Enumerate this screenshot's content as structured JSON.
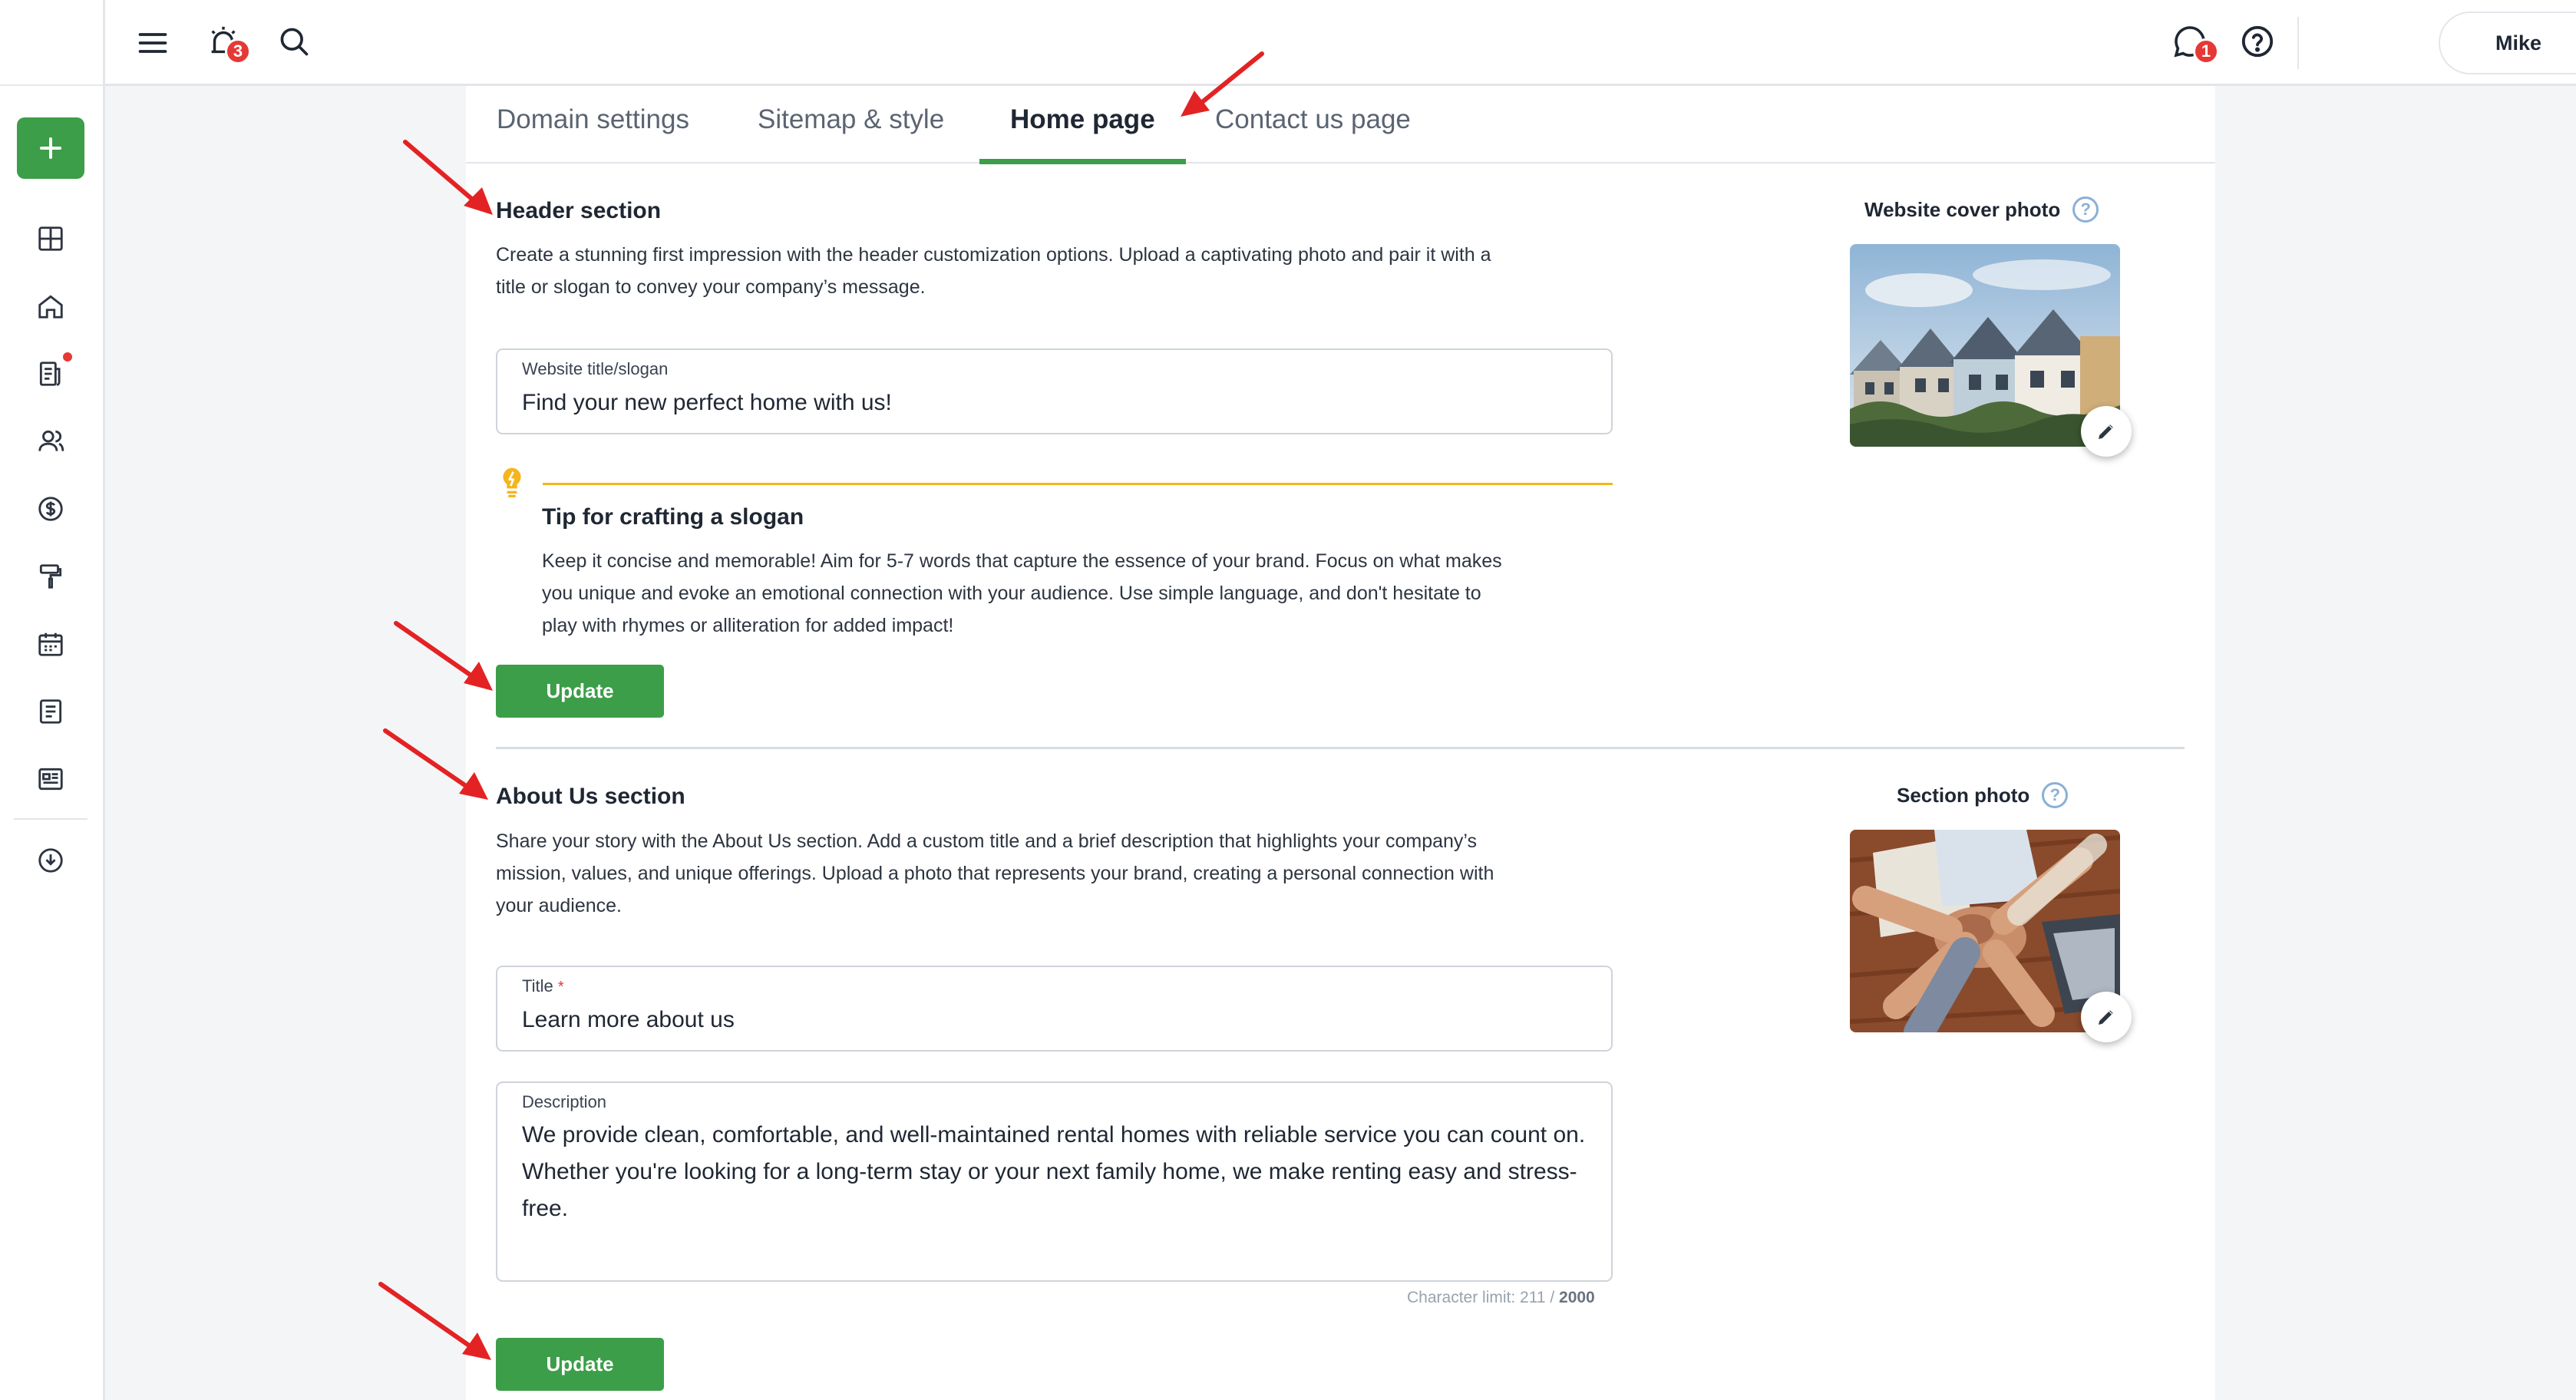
{
  "topbar": {
    "alarm_badge": "3",
    "chat_badge": "1",
    "user_name": "Mike"
  },
  "tabs": [
    {
      "label": "Domain settings"
    },
    {
      "label": "Sitemap & style"
    },
    {
      "label": "Home page"
    },
    {
      "label": "Contact us page"
    }
  ],
  "header_section": {
    "title": "Header section",
    "description_line1": "Create a stunning first impression with the header customization options. Upload a captivating photo and pair it with a",
    "description_line2": "title or slogan to convey your company’s message.",
    "field_label": "Website title/slogan",
    "field_value": "Find your new perfect home with us!",
    "tip_title": "Tip for crafting a slogan",
    "tip_line1": "Keep it concise and memorable! Aim for 5-7 words that capture the essence of your brand. Focus on what makes",
    "tip_line2": "you unique and evoke an emotional connection with your audience. Use simple language, and don't hesitate to",
    "tip_line3": "play with rhymes or alliteration for added impact!",
    "update_label": "Update",
    "photo_label": "Website cover photo"
  },
  "about_section": {
    "title": "About Us section",
    "description_line1": "Share your story with the About Us section. Add a custom title and a brief description that highlights your company’s",
    "description_line2": "mission, values, and unique offerings. Upload a photo that represents your brand, creating a personal connection with",
    "description_line3": "your audience.",
    "title_label": "Title",
    "title_required": "*",
    "title_value": "Learn more about us",
    "description_label": "Description",
    "description_value": "We provide clean, comfortable, and well-maintained rental homes with reliable service you can count on. Whether you're looking for a long-term stay or your next family home, we make renting easy and stress-free.",
    "char_limit_text": "Character limit: 211 / ",
    "char_limit_max": "2000",
    "update_label": "Update",
    "photo_label": "Section photo"
  },
  "help_glyph": "?",
  "colors": {
    "accent_green": "#3c9e48",
    "badge_red": "#e53935",
    "tip_yellow": "#f5b51c"
  }
}
